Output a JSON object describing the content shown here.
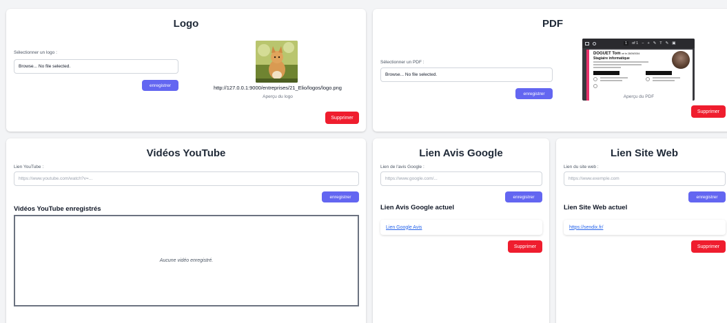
{
  "logo_card": {
    "title": "Logo",
    "select_label": "Sélectionner un logo :",
    "file_input_value": "Browse... No file selected.",
    "save_label": "enregistrer",
    "logo_path": "http://127.0.0.1:9000/entreprises/21_Elio/logos/logo.png",
    "preview_caption": "Aperçu du logo",
    "delete_label": "Supprimer"
  },
  "pdf_card": {
    "title": "PDF",
    "select_label": "Sélectionner un PDF :",
    "file_input_value": "Browse... No file selected.",
    "save_label": "enregistrer",
    "preview_caption": "Aperçu du PDF",
    "delete_label": "Supprimer",
    "viewer": {
      "page_current": "1",
      "page_total": "of 1",
      "doc_name": "DOGUET Tom",
      "doc_born": "né le 28/09/2004",
      "doc_role": "Stagiaire informatique"
    }
  },
  "youtube_card": {
    "title": "Vidéos YouTube",
    "link_label": "Lien YouTube :",
    "link_placeholder": "https://www.youtube.com/watch?v=...",
    "save_label": "enregistrer",
    "saved_heading": "Vidéos YouTube enregistrés",
    "empty_text": "Aucune vidéo enregistré."
  },
  "google_card": {
    "title": "Lien Avis Google",
    "link_label": "Lien de l'avis Google :",
    "link_placeholder": "https://www.google.com/...",
    "save_label": "enregistrer",
    "current_heading": "Lien Avis Google actuel",
    "current_link": "Lien Google Avis",
    "delete_label": "Supprimer"
  },
  "website_card": {
    "title": "Lien Site Web",
    "link_label": "Lien du site web :",
    "link_placeholder": "https://www.exemple.com",
    "save_label": "enregistrer",
    "current_heading": "Lien Site Web actuel",
    "current_link": "https://sendix.fr/",
    "delete_label": "Supprimer"
  },
  "colors": {
    "primary": "#6366f1",
    "danger": "#ef1d2e",
    "link": "#2563eb"
  }
}
